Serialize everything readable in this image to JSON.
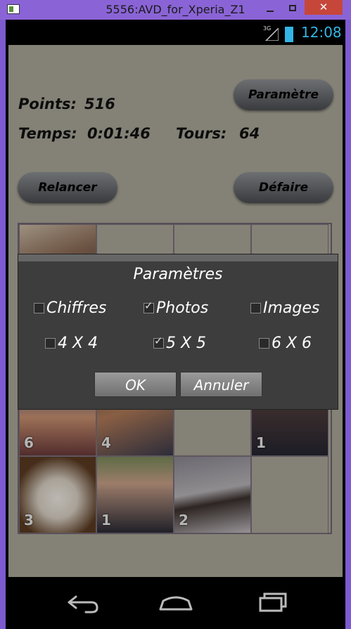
{
  "window": {
    "title": "5556:AVD_for_Xperia_Z1",
    "close_label": "✕"
  },
  "statusbar": {
    "signal_label": "3G",
    "time": "12:08"
  },
  "header": {
    "points_label": "Points:",
    "points_value": "516",
    "time_label": "Temps:",
    "time_value": "0:01:46",
    "turns_label": "Tours:",
    "turns_value": "64",
    "settings_button": "Paramètre"
  },
  "actions": {
    "restart_button": "Relancer",
    "undo_button": "Défaire"
  },
  "grid": {
    "visible_tiles": [
      {
        "slot": "row1-col1",
        "label": ""
      },
      {
        "slot": "row3-col1",
        "label": "6"
      },
      {
        "slot": "row3-col2",
        "label": "4"
      },
      {
        "slot": "row3-col4",
        "label": "1"
      },
      {
        "slot": "row4-col1",
        "label": "3"
      },
      {
        "slot": "row4-col2",
        "label": "1"
      },
      {
        "slot": "row4-col3",
        "label": "2"
      }
    ]
  },
  "dialog": {
    "title": "Paramètres",
    "type_options": [
      {
        "label": "Chiffres",
        "checked": false
      },
      {
        "label": "Photos",
        "checked": true
      },
      {
        "label": "Images",
        "checked": false
      }
    ],
    "size_options": [
      {
        "label": "4 X 4",
        "checked": false
      },
      {
        "label": "5 X 5",
        "checked": true
      },
      {
        "label": "6 X 6",
        "checked": false
      }
    ],
    "ok_button": "OK",
    "cancel_button": "Annuler"
  },
  "colors": {
    "app_background": "#a9a698",
    "accent": "#33b5e5",
    "dialog_background": "#3d3d3d"
  },
  "navbar": {
    "icons": [
      "back-icon",
      "home-icon",
      "recents-icon"
    ]
  }
}
